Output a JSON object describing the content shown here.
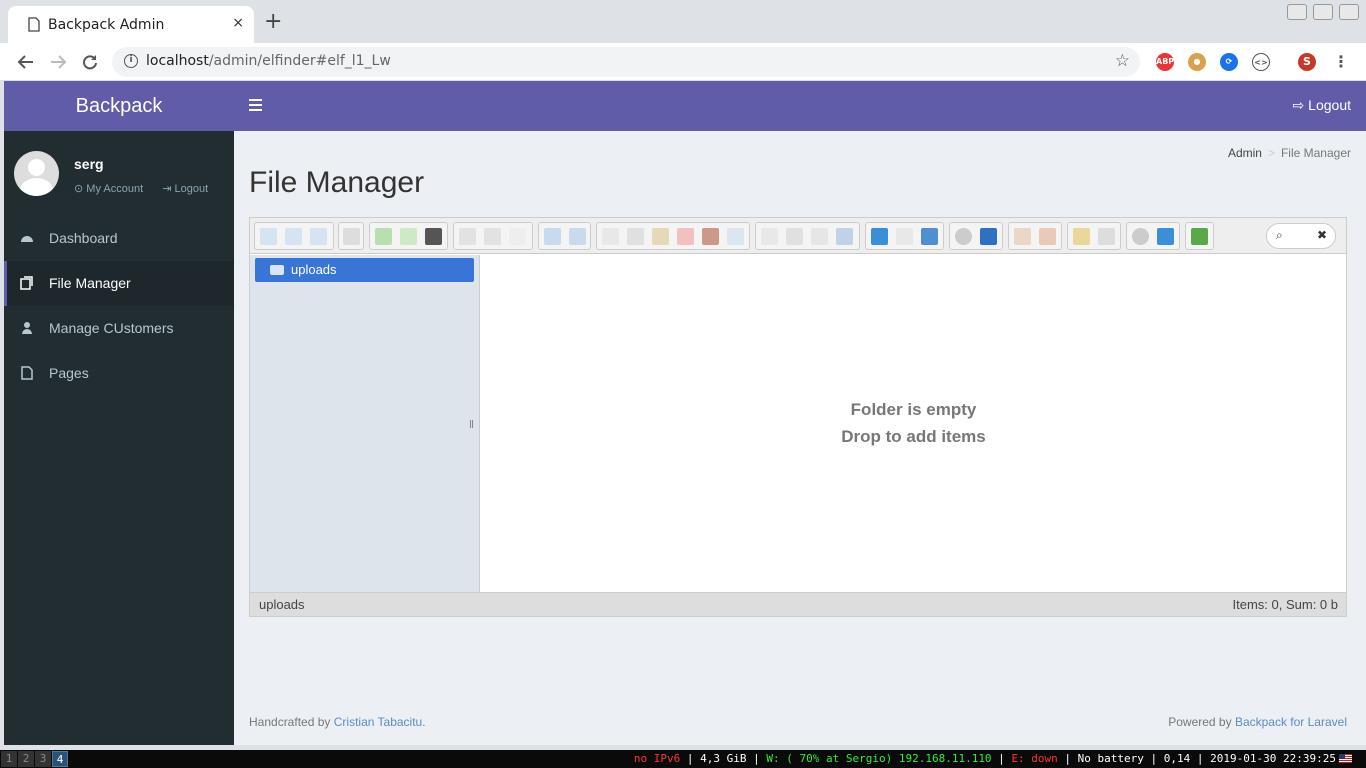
{
  "browser": {
    "tab_title": "Backpack Admin",
    "tab_close": "×",
    "new_tab": "+",
    "url_host": "localhost",
    "url_path": "/admin/elfinder#elf_l1_Lw",
    "extensions": [
      "ABP",
      "cookie",
      "sync",
      "code",
      "S"
    ]
  },
  "sidebar": {
    "brand": "Backpack",
    "user": {
      "name": "serg",
      "my_account": "My Account",
      "logout": "Logout"
    },
    "items": [
      {
        "label": "Dashboard",
        "icon": "dashboard-icon",
        "active": false
      },
      {
        "label": "File Manager",
        "icon": "files-icon",
        "active": true
      },
      {
        "label": "Manage CUstomers",
        "icon": "user-icon",
        "active": false
      },
      {
        "label": "Pages",
        "icon": "file-icon",
        "active": false
      }
    ]
  },
  "topbar": {
    "logout": "Logout"
  },
  "content": {
    "breadcrumb": {
      "admin": "Admin",
      "sep": ">",
      "current": "File Manager"
    },
    "page_title": "File Manager"
  },
  "elfinder": {
    "tree_root": "uploads",
    "empty_line1": "Folder is empty",
    "empty_line2": "Drop to add items",
    "status_left": "uploads",
    "status_right": "Items: 0, Sum: 0 b"
  },
  "footer": {
    "left_prefix": "Handcrafted by",
    "left_link": "Cristian Tabacitu",
    "left_suffix": ".",
    "right_prefix": "Powered by",
    "right_link": "Backpack for Laravel"
  },
  "statusbar": {
    "workspaces": [
      "1",
      "2",
      "3",
      "4"
    ],
    "active_workspace": "4",
    "ipv6": "no IPv6",
    "mem": "4,3 GiB",
    "wifi": "W: ( 70% at Sergio) 192.168.11.110",
    "eth": "E: down",
    "battery": "No battery",
    "load": "0,14",
    "datetime": "2019-01-30 22:39:25",
    "colors": {
      "red": "#ff3333",
      "green": "#33ee33",
      "white": "#ffffff"
    }
  },
  "colors": {
    "brand": "#605ca8",
    "sidebar": "#222d32",
    "selection": "#3875d7"
  }
}
